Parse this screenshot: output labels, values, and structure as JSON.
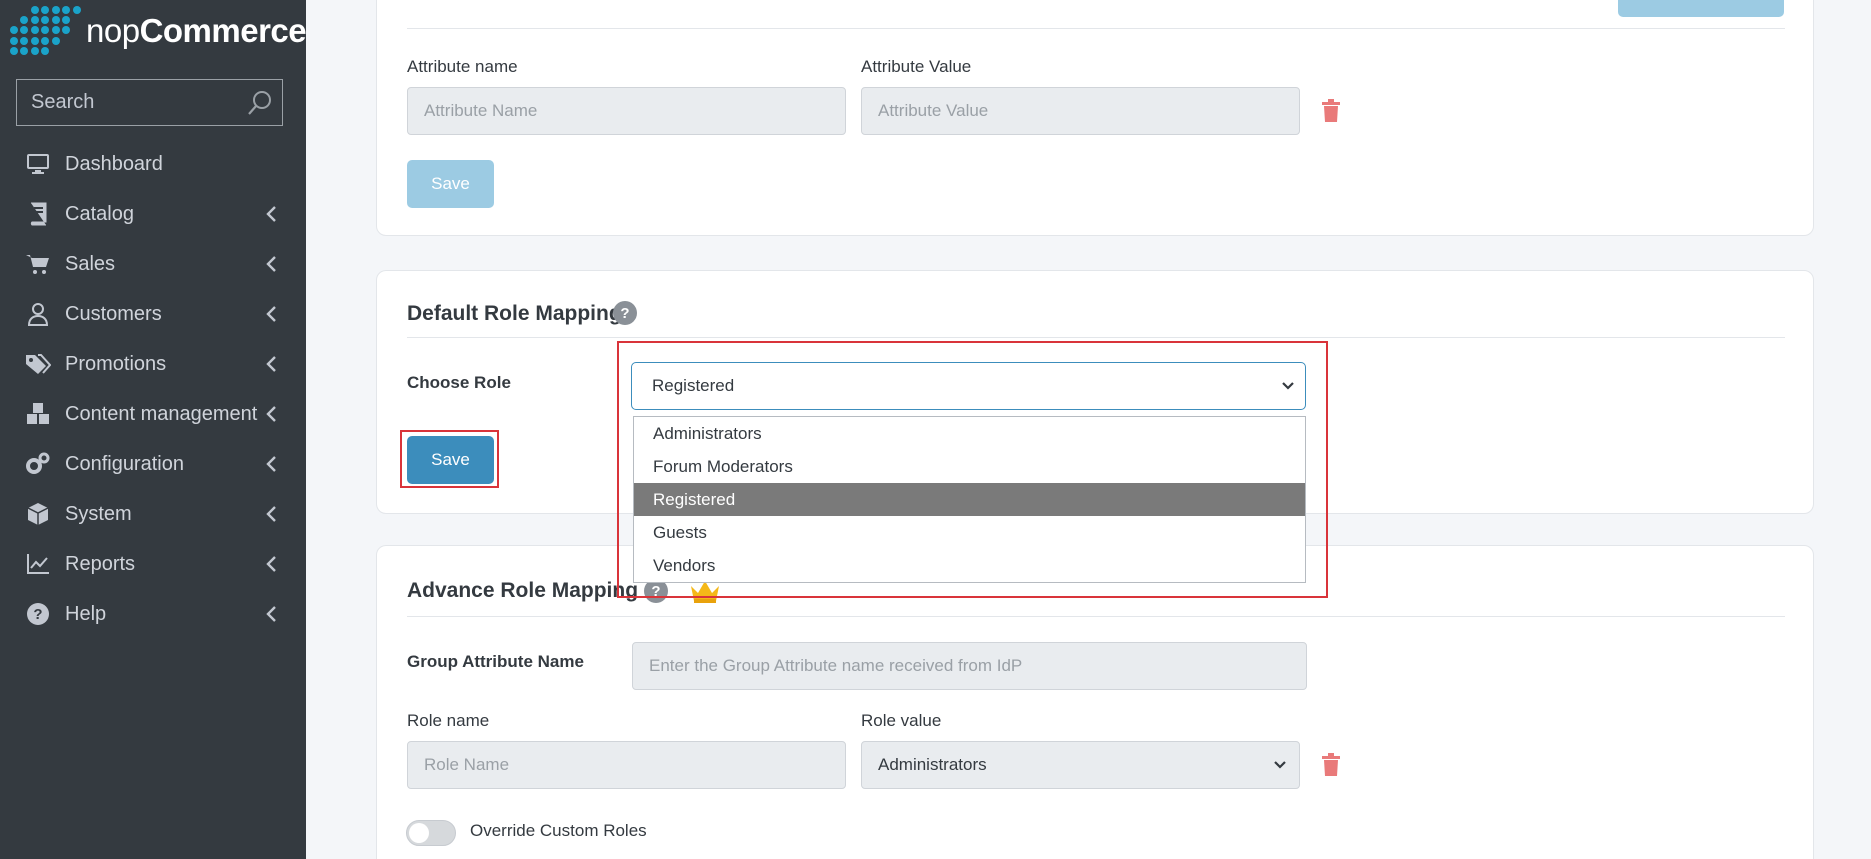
{
  "brand": {
    "prefix": "nop",
    "suffix": "Commerce"
  },
  "sidebar": {
    "search_placeholder": "Search",
    "items": [
      {
        "label": "Dashboard",
        "icon": "monitor-icon",
        "chevron": false
      },
      {
        "label": "Catalog",
        "icon": "book-icon",
        "chevron": true
      },
      {
        "label": "Sales",
        "icon": "cart-icon",
        "chevron": true
      },
      {
        "label": "Customers",
        "icon": "user-icon",
        "chevron": true
      },
      {
        "label": "Promotions",
        "icon": "tags-icon",
        "chevron": true
      },
      {
        "label": "Content management",
        "icon": "cubes-icon",
        "chevron": true
      },
      {
        "label": "Configuration",
        "icon": "gears-icon",
        "chevron": true
      },
      {
        "label": "System",
        "icon": "cube-icon",
        "chevron": true
      },
      {
        "label": "Reports",
        "icon": "line-chart-icon",
        "chevron": true
      },
      {
        "label": "Help",
        "icon": "question-circle-icon",
        "chevron": true
      }
    ]
  },
  "custom_attr": {
    "name_label": "Attribute name",
    "value_label": "Attribute Value",
    "name_placeholder": "Attribute Name",
    "value_placeholder": "Attribute Value",
    "save_label": "Save"
  },
  "default_role": {
    "title": "Default Role Mapping",
    "choose_role_label": "Choose Role",
    "selected": "Registered",
    "options": [
      "Administrators",
      "Forum Moderators",
      "Registered",
      "Guests",
      "Vendors"
    ],
    "highlighted_index": 2,
    "save_label": "Save"
  },
  "advance_role": {
    "title": "Advance Role Mapping",
    "group_attr_label": "Group Attribute Name",
    "group_attr_placeholder": "Enter the Group Attribute name received from IdP",
    "role_name_label": "Role name",
    "role_value_label": "Role value",
    "role_name_placeholder": "Role Name",
    "role_value_selected": "Administrators",
    "override_label": "Override Custom Roles"
  },
  "colors": {
    "sidebar_bg": "#343a40",
    "primary": "#3c8dbc",
    "highlight_box": "#d9343a",
    "trash": "#e97a7a"
  }
}
